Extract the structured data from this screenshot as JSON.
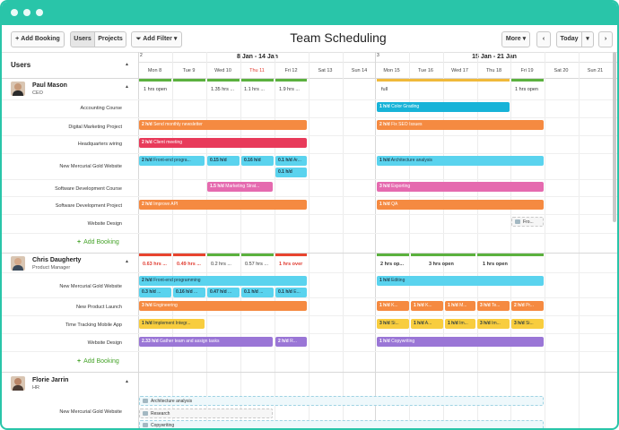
{
  "colors": {
    "accent": "#29c5a9",
    "orange": "#f58a41",
    "cyan": "#5ad3ee",
    "cyan_dark": "#17b3d8",
    "red": "#e83a5a",
    "magenta": "#e56aaf",
    "purple": "#9a76d6",
    "yellow": "#f8cd3e",
    "green": "#46a32a"
  },
  "toolbar": {
    "add_booking": "Add Booking",
    "users": "Users",
    "projects": "Projects",
    "add_filter": "Add Filter",
    "title": "Team Scheduling",
    "more": "More",
    "today": "Today"
  },
  "header": {
    "users": "Users",
    "week1": "8 Jan - 14 Jan",
    "week1_num": "2",
    "week2": "15 Jan - 21 Jan",
    "week2_num": "3",
    "days": [
      "Mon 8",
      "Tue 9",
      "Wed 10",
      "Thu 11",
      "Fri 12",
      "Sat 13",
      "Sun 14",
      "Mon 15",
      "Tue 16",
      "Wed 17",
      "Thu 18",
      "Fri 19",
      "Sat 20",
      "Sun 21"
    ]
  },
  "people": [
    {
      "name": "Paul Mason",
      "role": "CEO",
      "capacity": [
        "1 hrs open",
        "",
        "1.35 hrs ...",
        "1.1 hrs ...",
        "1.9 hrs ...",
        "full",
        "1 hrs open"
      ],
      "rows": [
        "Accounting Course",
        "Digital Marketing Project",
        "Headquarters wiring",
        "New Mercurial Gold Website",
        "Software Development Course",
        "Software Development Project",
        "Website Design"
      ],
      "add_booking": "Add Booking",
      "bars": {
        "b1": {
          "hd": "1 h/d",
          "text": "Color Grading"
        },
        "b2": {
          "hd": "2 h/d",
          "text": "Send monthly newsletter"
        },
        "b3": {
          "hd": "2 h/d",
          "text": "Fix SEO Issues"
        },
        "b4": {
          "hd": "2 h/d",
          "text": "Client meeting"
        },
        "b5": {
          "hd": "2 h/d",
          "text": "Front-end progra..."
        },
        "b6": {
          "hd": "0.15 h/d",
          "text": ""
        },
        "b7": {
          "hd": "0.16 h/d",
          "text": ""
        },
        "b8": {
          "hd": "0.1 h/d",
          "text": "Ar..."
        },
        "b9": {
          "hd": "0.1 h/d",
          "text": ""
        },
        "b10": {
          "hd": "1 h/d",
          "text": "Architecture analysis"
        },
        "b11": {
          "hd": "1.5 h/d",
          "text": "Marketing Strat..."
        },
        "b12": {
          "hd": "3 h/d",
          "text": "Exporting"
        },
        "b13": {
          "hd": "2 h/d",
          "text": "Improve API"
        },
        "b14": {
          "hd": "1 h/d",
          "text": "QA"
        },
        "b15": {
          "hd": "",
          "text": "Fro..."
        }
      }
    },
    {
      "name": "Chris Daugherty",
      "role": "Product Manager",
      "capacity": [
        "0.63 hrs ...",
        "0.49 hrs ...",
        "0.2 hrs ...",
        "0.57 hrs ...",
        "1 hrs over",
        "2 hrs op...",
        "3 hrs open",
        "1 hrs open"
      ],
      "rows": [
        "New Mercurial Gold Website",
        "New Product Launch",
        "Time Tracking Mobile App",
        "Website Design"
      ],
      "add_booking": "Add Booking",
      "bars": {
        "c1": {
          "hd": "2 h/d",
          "text": "Front-end programming"
        },
        "c2": {
          "hd": "1 h/d",
          "text": "Editing"
        },
        "c3": {
          "hd": "0.3 h/d",
          "text": "..."
        },
        "c4": {
          "hd": "0.16 h/d",
          "text": "..."
        },
        "c5": {
          "hd": "0.47 h/d",
          "text": "..."
        },
        "c6": {
          "hd": "0.1 h/d",
          "text": "..."
        },
        "c7": {
          "hd": "0.1 h/d",
          "text": "E..."
        },
        "c8": {
          "hd": "3 h/d",
          "text": "Engineering"
        },
        "c9": {
          "hd": "1 h/d",
          "text": "K..."
        },
        "c10": {
          "hd": "1 h/d",
          "text": "K..."
        },
        "c11": {
          "hd": "1 h/d",
          "text": "M..."
        },
        "c12": {
          "hd": "3 h/d",
          "text": "Te..."
        },
        "c13": {
          "hd": "2 h/d",
          "text": "Pr..."
        },
        "c14": {
          "hd": "1 h/d",
          "text": "Implement Integr..."
        },
        "c15": {
          "hd": "3 h/d",
          "text": "Si..."
        },
        "c16": {
          "hd": "1 h/d",
          "text": "A..."
        },
        "c17": {
          "hd": "1 h/d",
          "text": "Im..."
        },
        "c18": {
          "hd": "3 h/d",
          "text": "Im..."
        },
        "c19": {
          "hd": "3 h/d",
          "text": "Si..."
        },
        "c20": {
          "hd": "2.33 h/d",
          "text": "Gather team and assign tasks"
        },
        "c21": {
          "hd": "2 h/d",
          "text": "R..."
        },
        "c22": {
          "hd": "1 h/d",
          "text": "Copywriting"
        }
      }
    },
    {
      "name": "Florie Jarrin",
      "role": "HR",
      "rows": [
        "New Mercurial Gold Website"
      ],
      "bars": {
        "f1": {
          "text": "Architecture analysis"
        },
        "f2": {
          "text": "Research"
        },
        "f3": {
          "text": "Copywriting"
        }
      }
    }
  ]
}
